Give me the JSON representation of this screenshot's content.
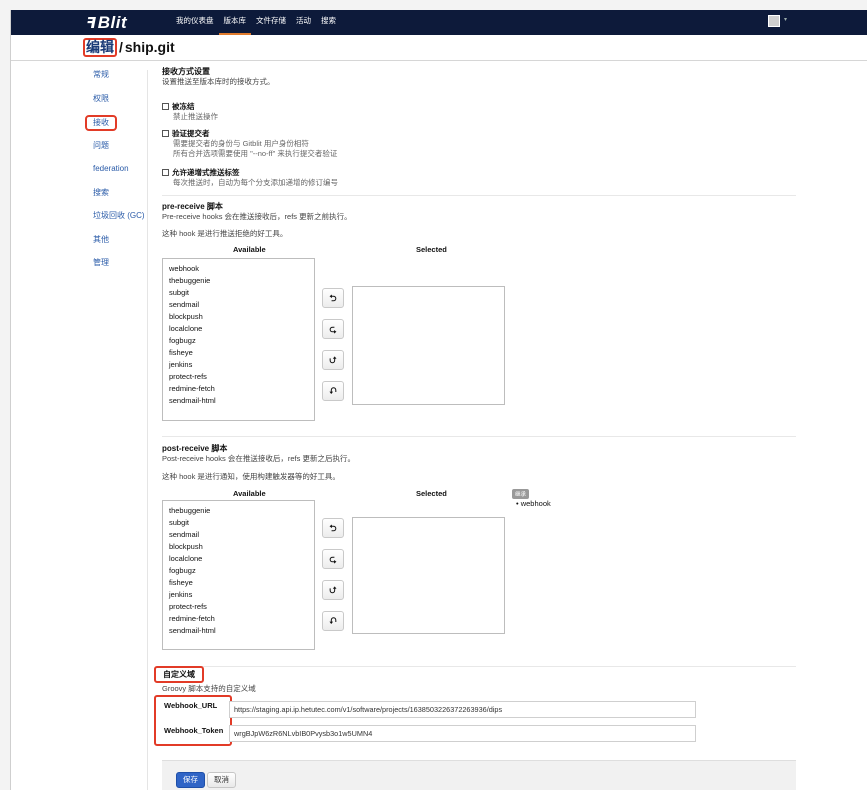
{
  "nav": {
    "logo_prefix": "ꟻ",
    "logo_text": "Blit",
    "items": [
      {
        "label": "我的仪表盘"
      },
      {
        "label": "版本库"
      },
      {
        "label": "文件存储"
      },
      {
        "label": "活动"
      },
      {
        "label": "搜索"
      }
    ],
    "active_index": 1
  },
  "title": {
    "edit": "编辑",
    "sep": "/",
    "repo": "ship.git"
  },
  "sidebar": {
    "items": [
      {
        "label": "常规"
      },
      {
        "label": "权限"
      },
      {
        "label": "接收"
      },
      {
        "label": "问题"
      },
      {
        "label": "federation"
      },
      {
        "label": "搜索"
      },
      {
        "label": "垃圾回收 (GC)"
      },
      {
        "label": "其他"
      },
      {
        "label": "管理"
      }
    ],
    "active_index": 2
  },
  "receive": {
    "heading": "接收方式设置",
    "desc": "设置推送至版本库时的接收方式。",
    "options": [
      {
        "label": "被冻结",
        "help": [
          "禁止推送操作"
        ]
      },
      {
        "label": "验证提交者",
        "help": [
          "需要提交者的身份与 Gitblit 用户身份相符",
          "所有合并选项需要使用 \"--no-ff\" 来执行提交者验证"
        ]
      },
      {
        "label": "允许递增式推送标签",
        "help": [
          "每次推送时，自动为每个分支添加递增的修订编号"
        ]
      }
    ]
  },
  "pre_receive": {
    "heading": "pre-receive 脚本",
    "desc": "Pre-receive hooks 会在推送接收后，refs 更新之前执行。",
    "note": "这种 hook 是进行推送拒绝的好工具。",
    "available_label": "Available",
    "selected_label": "Selected",
    "available": [
      "webhook",
      "thebuggenie",
      "subgit",
      "sendmail",
      "blockpush",
      "localclone",
      "fogbugz",
      "fisheye",
      "jenkins",
      "protect-refs",
      "redmine-fetch",
      "sendmail-html"
    ]
  },
  "post_receive": {
    "heading": "post-receive 脚本",
    "desc": "Post-receive hooks 会在推送接收后，refs 更新之后执行。",
    "note": "这种 hook 是进行通知，使用构建触发器等的好工具。",
    "available_label": "Available",
    "selected_label": "Selected",
    "inherited_badge": "继承",
    "inherited": [
      "webhook"
    ],
    "available": [
      "thebuggenie",
      "subgit",
      "sendmail",
      "blockpush",
      "localclone",
      "fogbugz",
      "fisheye",
      "jenkins",
      "protect-refs",
      "redmine-fetch",
      "sendmail-html"
    ]
  },
  "move_buttons": [
    "⮌",
    "⮎",
    "⮍",
    "⮏"
  ],
  "custom": {
    "heading": "自定义域",
    "desc": "Groovy 脚本支持的自定义域",
    "fields": [
      {
        "label": "Webhook_URL",
        "value": "https://staging.api.ip.hetutec.com/v1/software/projects/1638503226372263936/dips"
      },
      {
        "label": "Webhook_Token",
        "value": "wrgBJpW6zR6NLvbIB0Pvysb3o1w5UMN4"
      }
    ]
  },
  "footer": {
    "save": "保存",
    "cancel": "取消"
  }
}
